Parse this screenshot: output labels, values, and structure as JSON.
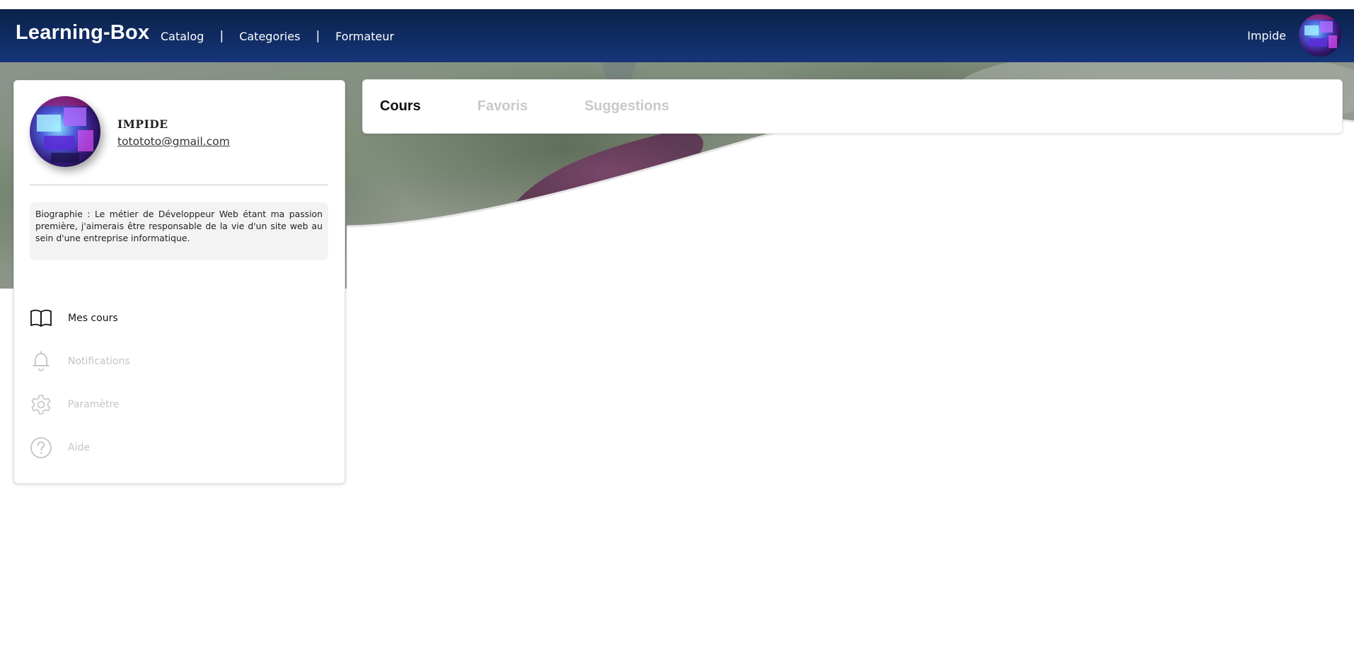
{
  "header": {
    "brand": "Learning-Box",
    "nav": [
      {
        "label": "Catalog"
      },
      {
        "label": "Categories"
      },
      {
        "label": "Formateur"
      }
    ],
    "separator": "|",
    "user_name": "Impide",
    "background_color": "#0f2a63"
  },
  "profile": {
    "name": "IMPIDE",
    "email": "totototo@gmail.com",
    "bio": "Biographie : Le métier de Développeur Web étant ma passion première, j'aimerais être responsable de la vie d'un site web au sein d'une entreprise informatique."
  },
  "menu": [
    {
      "label": "Mes cours",
      "icon": "book-open-icon",
      "active": true
    },
    {
      "label": "Notifications",
      "icon": "bell-icon",
      "active": false
    },
    {
      "label": "Paramètre",
      "icon": "gear-icon",
      "active": false
    },
    {
      "label": "Aide",
      "icon": "help-circle-icon",
      "active": false
    }
  ],
  "tabs": [
    {
      "label": "Cours",
      "active": true
    },
    {
      "label": "Favoris",
      "active": false
    },
    {
      "label": "Suggestions",
      "active": false
    }
  ],
  "colors": {
    "active_text": "#111111",
    "inactive_text": "#c4c4c4",
    "card_background": "#ffffff"
  }
}
